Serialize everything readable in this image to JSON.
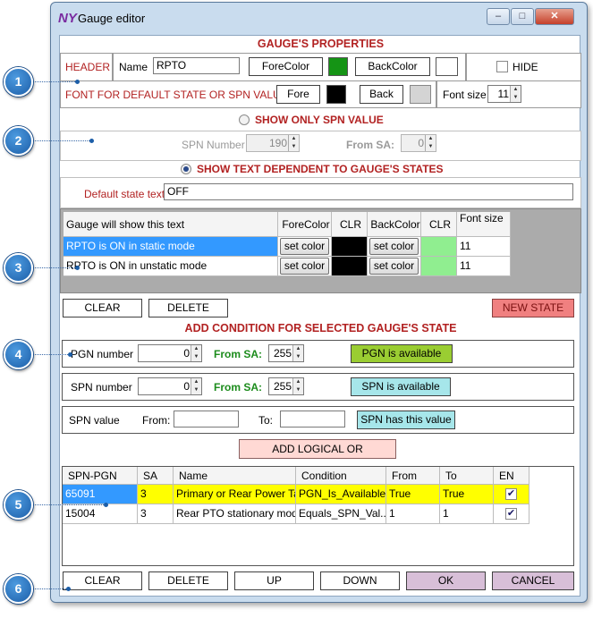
{
  "window": {
    "title": "Gauge editor",
    "logo": "NY"
  },
  "controls": {
    "minimize": "–",
    "maximize": "□",
    "close": "✕"
  },
  "properties": {
    "heading": "GAUGE'S PROPERTIES",
    "header_label": "HEADER",
    "name_label": "Name",
    "name_value": "RPTO",
    "forecolor_btn": "ForeColor",
    "backcolor_btn": "BackColor",
    "hide_label": "HIDE",
    "font_default_label": "FONT FOR DEFAULT STATE OR SPN VALUE",
    "fore_btn": "Fore",
    "back_btn": "Back",
    "font_size_label": "Font size",
    "font_size_value": "11",
    "colors": {
      "fore": "#159415",
      "fore2": "#000000",
      "back2": "#d4d4d4"
    }
  },
  "spn_only": {
    "label": "SHOW  ONLY SPN VALUE",
    "spn_number_label": "SPN Number",
    "spn_number_value": "190",
    "from_sa_label": "From SA:",
    "from_sa_value": "0"
  },
  "states": {
    "label": "SHOW TEXT DEPENDENT TO GAUGE'S STATES",
    "default_label": "Default state text",
    "default_value": "OFF",
    "columns": [
      "Gauge will show this text",
      "ForeColor",
      "CLR",
      "BackColor",
      "CLR",
      "Font size"
    ],
    "rows": [
      {
        "text": "RPTO is ON in static mode",
        "fore_btn": "set color",
        "back_btn": "set color",
        "size": "11"
      },
      {
        "text": "RPTO is ON in unstatic mode",
        "fore_btn": "set color",
        "back_btn": "set color",
        "size": "11"
      }
    ],
    "clear_btn": "CLEAR",
    "delete_btn": "DELETE",
    "new_state_btn": "NEW STATE"
  },
  "condition": {
    "heading": "ADD CONDITION FOR SELECTED GAUGE'S STATE",
    "pgn_label": "PGN number",
    "pgn_value": "0",
    "pgn_sa_label": "From SA:",
    "pgn_sa_value": "255",
    "pgn_btn": "PGN is available",
    "spn_label": "SPN number",
    "spn_value": "0",
    "spn_sa_label": "From SA:",
    "spn_sa_value": "255",
    "spn_btn": "SPN is available",
    "spnval_label": "SPN value",
    "from_label": "From:",
    "to_label": "To:",
    "spnval_btn": "SPN has this value",
    "logical_or_btn": "ADD LOGICAL OR"
  },
  "conditions_table": {
    "columns": [
      "SPN-PGN",
      "SA",
      "Name",
      "Condition",
      "From",
      "To",
      "EN"
    ],
    "rows": [
      {
        "spnpgn": "65091",
        "sa": "3",
        "name": "Primary or Rear Power Ta...",
        "cond": "PGN_Is_Available",
        "from": "True",
        "to": "True"
      },
      {
        "spnpgn": "15004",
        "sa": "3",
        "name": "Rear PTO stationary mode",
        "cond": "Equals_SPN_Val...",
        "from": "1",
        "to": "1"
      }
    ]
  },
  "bottom": {
    "clear": "CLEAR",
    "delete": "DELETE",
    "up": "UP",
    "down": "DOWN",
    "ok": "OK",
    "cancel": "CANCEL"
  },
  "markers": [
    "1",
    "2",
    "3",
    "4",
    "5",
    "6"
  ]
}
